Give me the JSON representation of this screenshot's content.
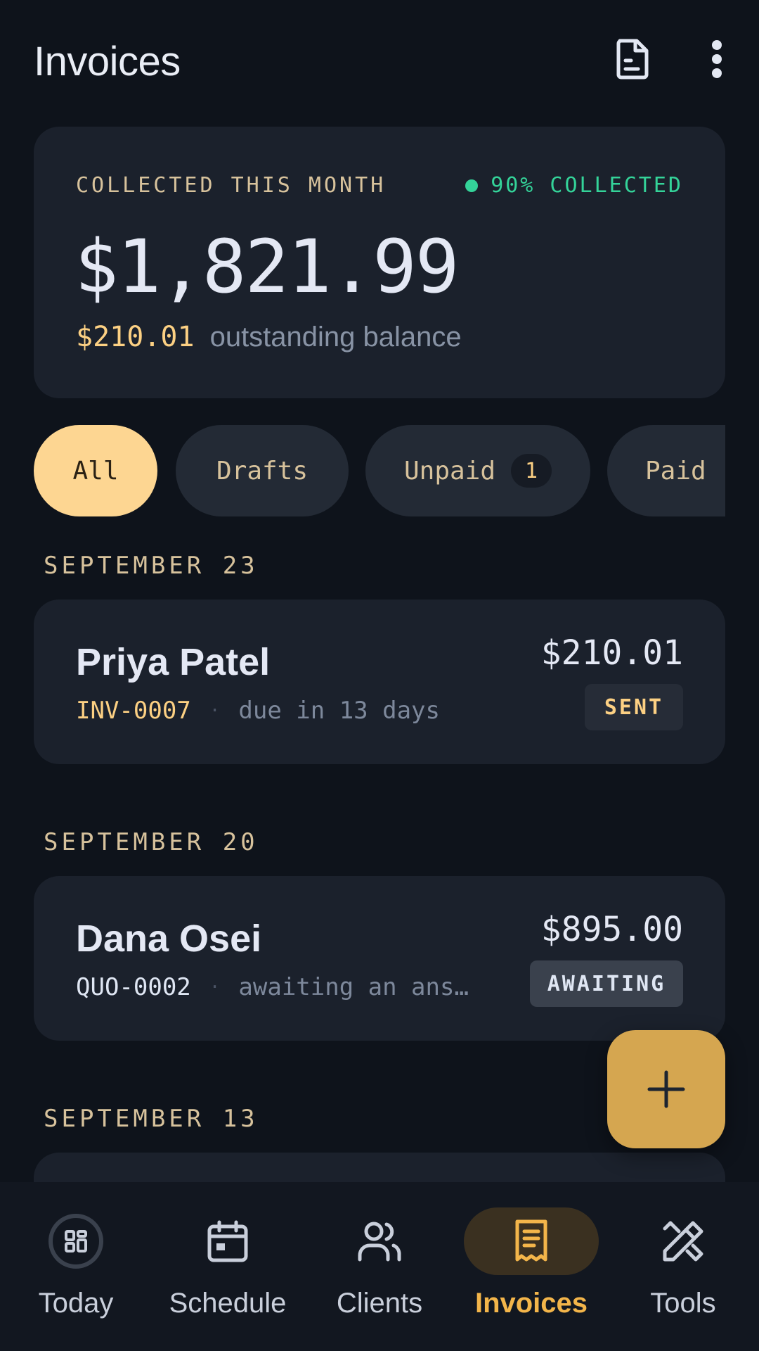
{
  "header": {
    "title": "Invoices"
  },
  "summary": {
    "label": "COLLECTED THIS MONTH",
    "rate": "90% COLLECTED",
    "amount": "$1,821.99",
    "outstanding_amount": "$210.01",
    "outstanding_text": "outstanding balance"
  },
  "filters": [
    {
      "label": "All"
    },
    {
      "label": "Drafts"
    },
    {
      "label": "Unpaid",
      "count": "1"
    },
    {
      "label": "Paid"
    }
  ],
  "sections": [
    {
      "date": "SEPTEMBER 23",
      "invoice": {
        "client": "Priya Patel",
        "number": "INV-0007",
        "sep": "·",
        "desc": "due in 13 days",
        "amount": "$210.01",
        "status": "SENT"
      }
    },
    {
      "date": "SEPTEMBER 20",
      "invoice": {
        "client": "Dana Osei",
        "number": "QUO-0002",
        "sep": "·",
        "desc": "awaiting an ans…",
        "amount": "$895.00",
        "status": "AWAITING"
      }
    },
    {
      "date": "SEPTEMBER 13"
    }
  ],
  "nav": [
    {
      "label": "Today",
      "icon": "dashboard-icon"
    },
    {
      "label": "Schedule",
      "icon": "calendar-icon"
    },
    {
      "label": "Clients",
      "icon": "users-icon"
    },
    {
      "label": "Invoices",
      "icon": "receipt-icon"
    },
    {
      "label": "Tools",
      "icon": "tools-icon"
    }
  ],
  "colors": {
    "accent": "#fdd692",
    "success": "#34d399",
    "active_nav": "#f3b54a",
    "fab": "#d5a650",
    "background": "#0e131b"
  }
}
